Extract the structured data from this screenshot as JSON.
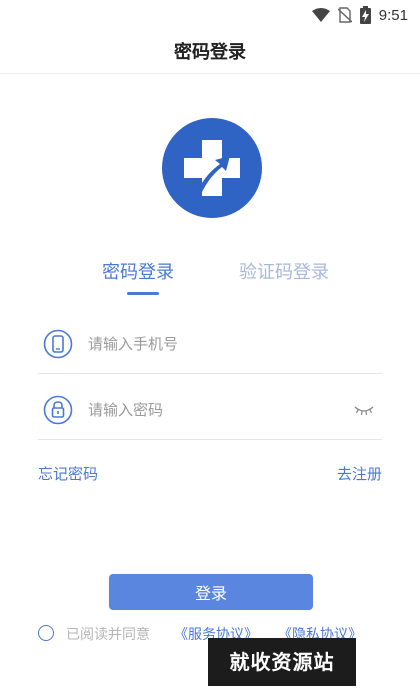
{
  "status_bar": {
    "time": "9:51",
    "icons": [
      "wifi-icon",
      "no-sim-icon",
      "battery-charging-icon"
    ]
  },
  "header": {
    "title": "密码登录"
  },
  "logo": {
    "icon": "medical-cross-logo",
    "color": "#2f63c4"
  },
  "tabs": [
    {
      "label": "密码登录",
      "active": true
    },
    {
      "label": "验证码登录",
      "active": false
    }
  ],
  "form": {
    "phone": {
      "placeholder": "请输入手机号",
      "value": "",
      "icon": "phone-icon"
    },
    "password": {
      "placeholder": "请输入密码",
      "value": "",
      "icon": "lock-icon",
      "toggle_icon": "eye-closed-icon"
    }
  },
  "links": {
    "forgot_password": "忘记密码",
    "register": "去注册"
  },
  "login_button": {
    "label": "登录"
  },
  "agreement": {
    "text": "已阅读并同意",
    "service_link": "《服务协议》",
    "privacy_link": "《隐私协议》",
    "checked": false
  },
  "watermark": {
    "text": "就收资源站"
  },
  "colors": {
    "accent": "#4a78d6",
    "button": "#5b86df",
    "logo": "#2f63c4"
  }
}
